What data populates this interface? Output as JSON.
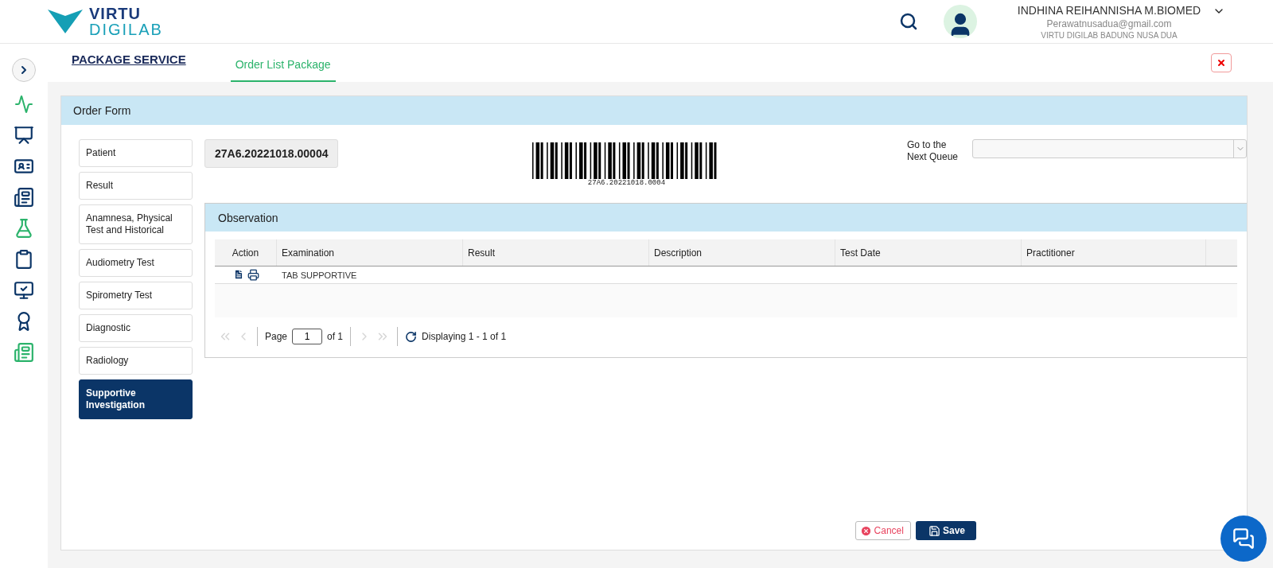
{
  "header": {
    "logo_line1": "VIRTU",
    "logo_line2": "DIGILAB",
    "user": {
      "name": "INDHINA REIHANNISHA M.BIOMED",
      "email": "Perawatnusadua@gmail.com",
      "location": "VIRTU DIGILAB BADUNG NUSA DUA"
    }
  },
  "page_title": "PACKAGE SERVICE",
  "tabs": [
    {
      "label": "Order List Package",
      "selected": true
    }
  ],
  "card": {
    "title": "Order Form"
  },
  "menu": [
    {
      "label": "Patient",
      "selected": false
    },
    {
      "label": "Result",
      "selected": false
    },
    {
      "label": "Anamnesa, Physical Test and Historical",
      "selected": false
    },
    {
      "label": "Audiometry Test",
      "selected": false
    },
    {
      "label": "Spirometry Test",
      "selected": false
    },
    {
      "label": "Diagnostic",
      "selected": false
    },
    {
      "label": "Radiology",
      "selected": false
    },
    {
      "label": "Supportive Investigation",
      "selected": true
    }
  ],
  "order_number": "27A6.20221018.00004",
  "barcode_text": "27A6.20221018.0004",
  "queue": {
    "label": "Go to the Next Queue"
  },
  "observation": {
    "title": "Observation",
    "columns": [
      "Action",
      "Examination",
      "Result",
      "Description",
      "Test Date",
      "Practitioner"
    ],
    "rows": [
      {
        "examination": "TAB SUPPORTIVE"
      }
    ],
    "pager": {
      "nav": [
        {
          "kind": "first",
          "disabled": true
        },
        {
          "kind": "prev",
          "disabled": true
        },
        {
          "kind": "next",
          "disabled": true
        },
        {
          "kind": "last",
          "disabled": true
        }
      ],
      "page_label": "Page",
      "page_value": "1",
      "of_label": "of 1",
      "displaying": "Displaying 1 - 1 of 1"
    }
  },
  "buttons": {
    "cancel": "Cancel",
    "save": "Save"
  }
}
